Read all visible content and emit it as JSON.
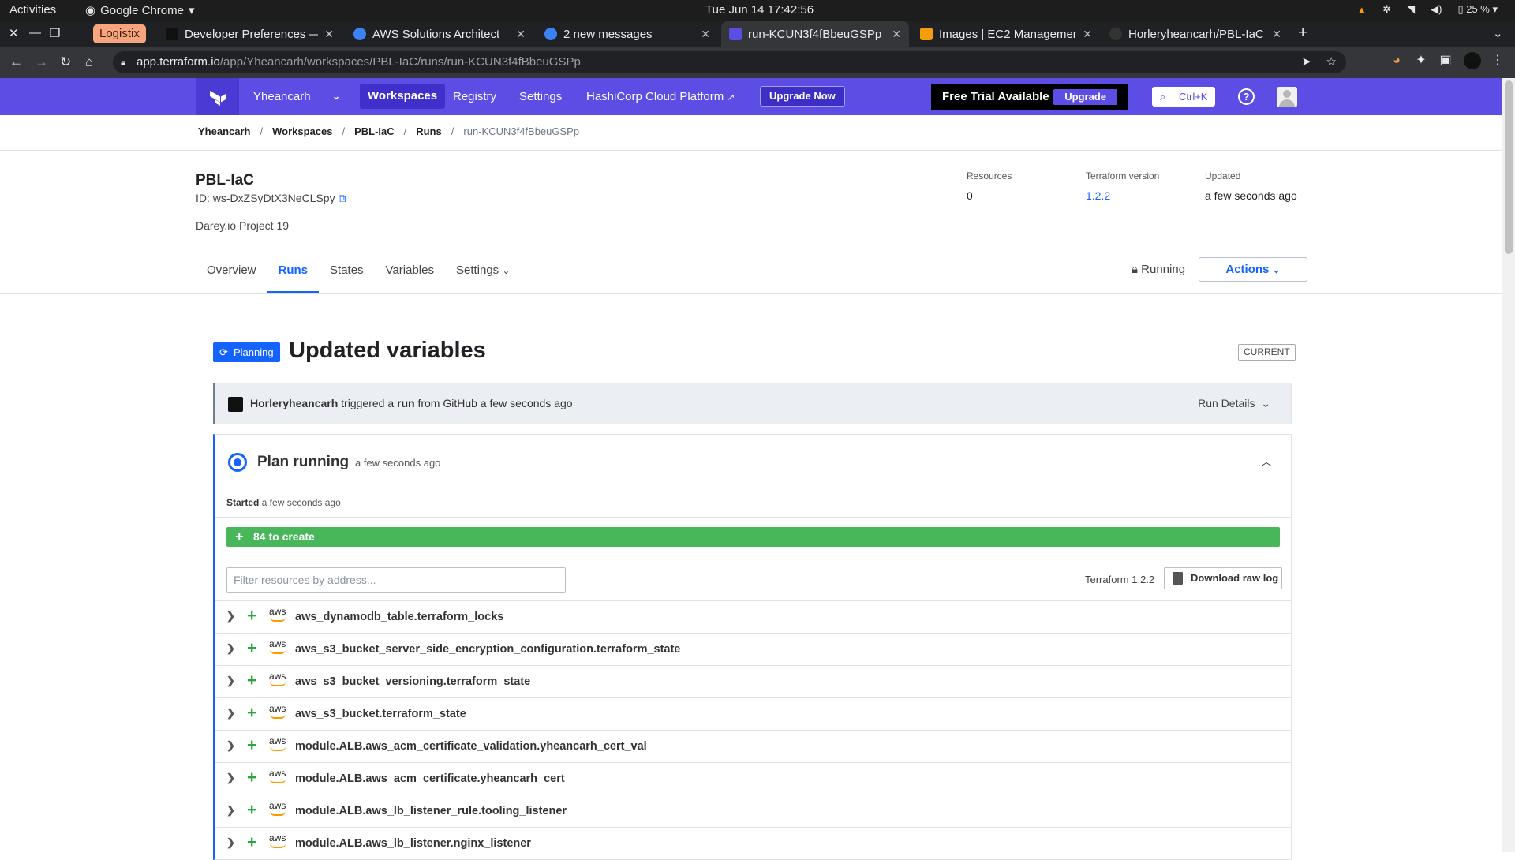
{
  "system": {
    "activities": "Activities",
    "app": "Google Chrome",
    "clock": "Tue Jun 14  17:42:56",
    "battery": "25 %"
  },
  "tabs": [
    {
      "title": "Developer Preferences —",
      "color": "#1d1d1d"
    },
    {
      "title": "AWS Solutions Architect",
      "color": "#3b82f6"
    },
    {
      "title": "2 new messages",
      "color": "#3b82f6"
    },
    {
      "title": "run-KCUN3f4fBbeuGSPp |",
      "color": "#5c4ee5"
    },
    {
      "title": "Images | EC2 Managemen",
      "color": "#f59e0b"
    },
    {
      "title": "Horleryheancarh/PBL-IaC",
      "color": "#333333"
    }
  ],
  "logistix": "Logistix",
  "url": {
    "host": "app.terraform.io",
    "path": "/app/Yheancarh/workspaces/PBL-IaC/runs/run-KCUN3f4fBbeuGSPp"
  },
  "nav": {
    "org": "Yheancarh",
    "workspaces": "Workspaces",
    "registry": "Registry",
    "settings": "Settings",
    "hcp": "HashiCorp Cloud Platform",
    "upgrade_now": "Upgrade Now",
    "trial": "Free Trial Available",
    "upgrade": "Upgrade",
    "search_hint": "Ctrl+K"
  },
  "breadcrumb": [
    "Yheancarh",
    "Workspaces",
    "PBL-IaC",
    "Runs",
    "run-KCUN3f4fBbeuGSPp"
  ],
  "workspace": {
    "name": "PBL-IaC",
    "id": "ID: ws-DxZSyDtX3NeCLSpy",
    "description": "Darey.io Project 19",
    "resources_label": "Resources",
    "resources": "0",
    "tf_label": "Terraform version",
    "tf_version": "1.2.2",
    "updated_label": "Updated",
    "updated": "a few seconds ago",
    "tabs": [
      "Overview",
      "Runs",
      "States",
      "Variables",
      "Settings"
    ],
    "status": "Running",
    "actions": "Actions"
  },
  "run": {
    "badge": "Planning",
    "title": "Updated variables",
    "current": "CURRENT",
    "user": "Horleryheancarh",
    "trigger_a": " triggered a ",
    "run_word": "run",
    "trigger_b": " from GitHub a few seconds ago",
    "details": "Run Details"
  },
  "plan": {
    "title": "Plan running",
    "ago": "a few seconds ago",
    "started_label": "Started",
    "started": " a few seconds ago",
    "summary": "84 to create",
    "filter_placeholder": "Filter resources by address...",
    "tf_version": "Terraform 1.2.2",
    "download": "Download raw log",
    "provider_label": "aws",
    "resources": [
      "aws_dynamodb_table.terraform_locks",
      "aws_s3_bucket_server_side_encryption_configuration.terraform_state",
      "aws_s3_bucket_versioning.terraform_state",
      "aws_s3_bucket.terraform_state",
      "module.ALB.aws_acm_certificate_validation.yheancarh_cert_val",
      "module.ALB.aws_acm_certificate.yheancarh_cert",
      "module.ALB.aws_lb_listener_rule.tooling_listener",
      "module.ALB.aws_lb_listener.nginx_listener"
    ]
  }
}
